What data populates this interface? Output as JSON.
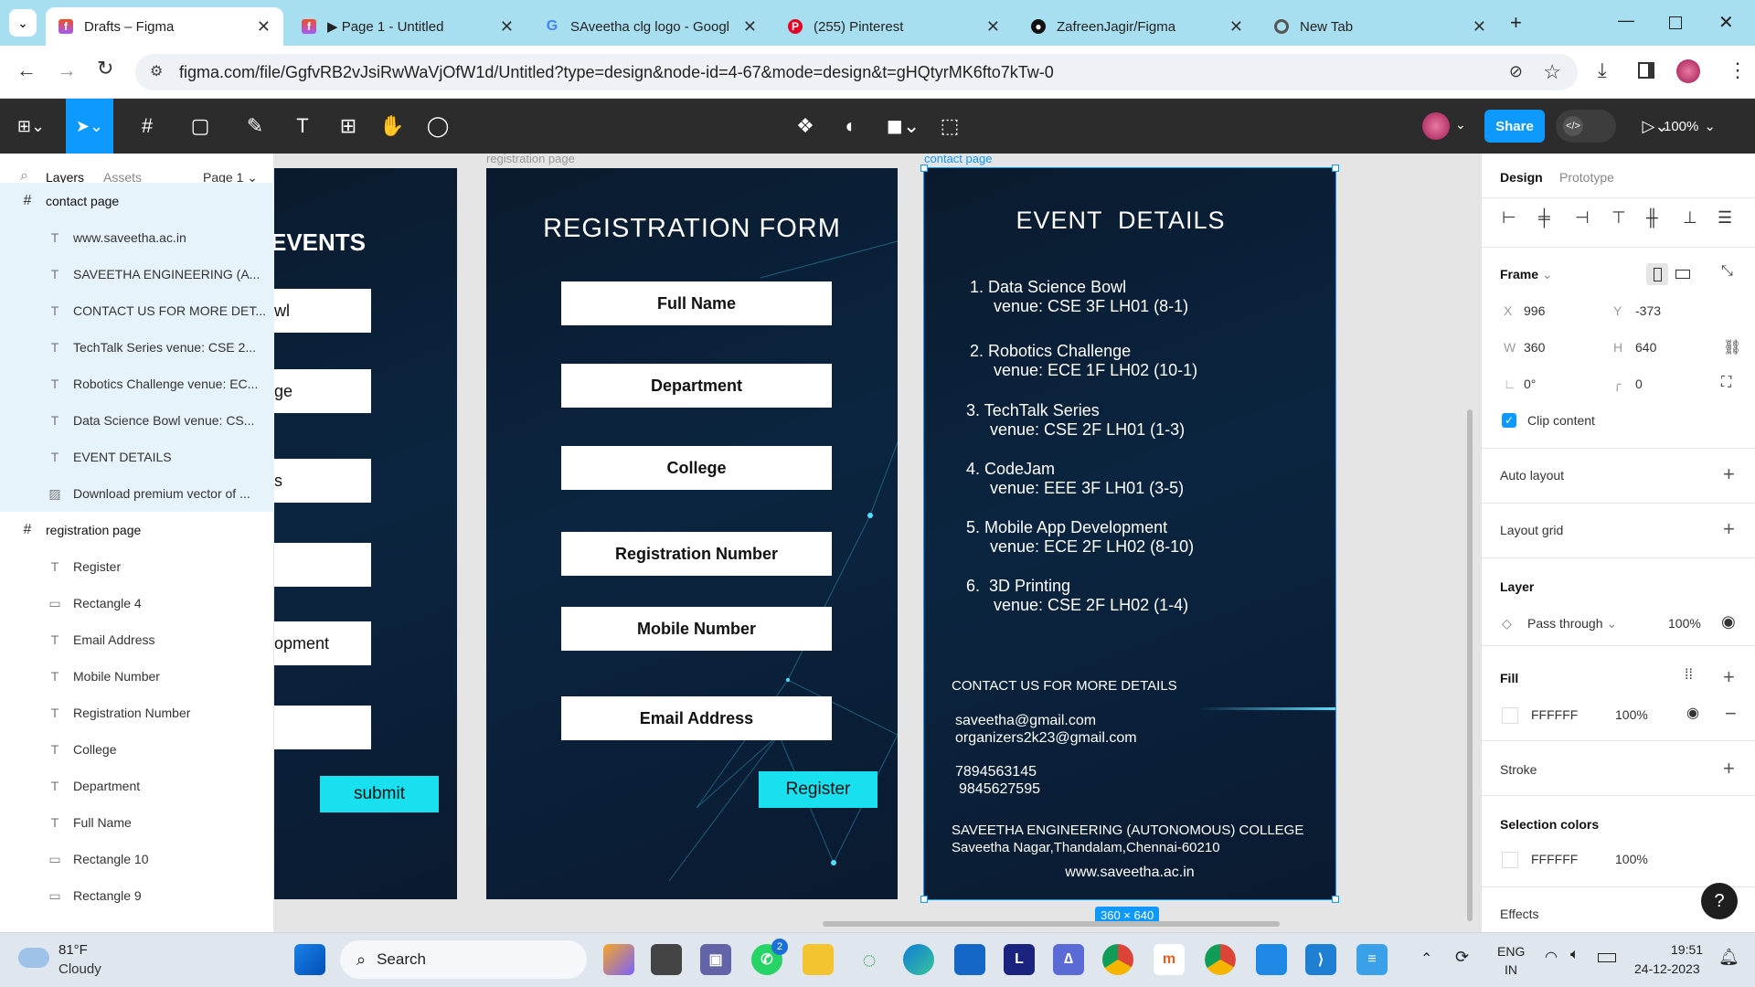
{
  "browser": {
    "tabs": [
      {
        "label": "Drafts – Figma",
        "icon": "figma-icon"
      },
      {
        "label": "▶ Page 1 - Untitled",
        "icon": "figma-icon"
      },
      {
        "label": "SAveetha clg logo - Googl",
        "icon": "google-icon"
      },
      {
        "label": "(255) Pinterest",
        "icon": "pinterest-icon"
      },
      {
        "label": "ZafreenJagir/Figma",
        "icon": "github-icon"
      },
      {
        "label": "New Tab",
        "icon": "chrome-icon"
      }
    ],
    "url": "figma.com/file/GgfvRB2vJsiRwWaVjOfW1d/Untitled?type=design&node-id=4-67&mode=design&t=gHQtyrMK6fto7kTw-0"
  },
  "figma_toolbar": {
    "share_label": "Share",
    "zoom": "100%"
  },
  "left_panel": {
    "tab_layers": "Layers",
    "tab_assets": "Assets",
    "page": "Page 1",
    "layers": [
      {
        "label": "contact page",
        "type": "frame",
        "selected": true
      },
      {
        "label": "www.saveetha.ac.in",
        "type": "text",
        "selected": true
      },
      {
        "label": "SAVEETHA ENGINEERING (A...",
        "type": "text",
        "selected": true
      },
      {
        "label": "CONTACT US FOR MORE DET...",
        "type": "text",
        "selected": true
      },
      {
        "label": "TechTalk Series venue: CSE 2...",
        "type": "text",
        "selected": true
      },
      {
        "label": "Robotics Challenge venue: EC...",
        "type": "text",
        "selected": true
      },
      {
        "label": "Data Science Bowl venue: CS...",
        "type": "text",
        "selected": true
      },
      {
        "label": "EVENT DETAILS",
        "type": "text",
        "selected": true
      },
      {
        "label": "Download premium vector of ...",
        "type": "image",
        "selected": true
      },
      {
        "label": "registration page",
        "type": "frame",
        "selected": false
      },
      {
        "label": "Register",
        "type": "text",
        "selected": false
      },
      {
        "label": "Rectangle 4",
        "type": "rect",
        "selected": false
      },
      {
        "label": "Email Address",
        "type": "text",
        "selected": false
      },
      {
        "label": "Mobile Number",
        "type": "text",
        "selected": false
      },
      {
        "label": "Registration Number",
        "type": "text",
        "selected": false
      },
      {
        "label": "College",
        "type": "text",
        "selected": false
      },
      {
        "label": "Department",
        "type": "text",
        "selected": false
      },
      {
        "label": "Full Name",
        "type": "text",
        "selected": false
      },
      {
        "label": "Rectangle 10",
        "type": "rect",
        "selected": false
      },
      {
        "label": "Rectangle 9",
        "type": "rect",
        "selected": false
      }
    ]
  },
  "canvas": {
    "left_frame": {
      "title": "EVENTS",
      "fields": [
        "wl",
        "ge",
        "s",
        "",
        "opment",
        ""
      ],
      "submit": "submit"
    },
    "registration": {
      "frame_label": "registration page",
      "title": "REGISTRATION FORM",
      "fields": [
        "Full Name",
        "Department",
        "College",
        "Registration Number",
        "Mobile Number",
        "Email  Address"
      ],
      "register": "Register"
    },
    "contact": {
      "frame_label": "contact page",
      "title": "EVENT  DETAILS",
      "events": [
        {
          "line1": "1. Data Science Bowl",
          "line2": "venue: CSE 3F LH01 (8-1)"
        },
        {
          "line1": "2. Robotics Challenge",
          "line2": "venue: ECE 1F LH02 (10-1)"
        },
        {
          "line1": "3. TechTalk Series",
          "line2": "venue: CSE 2F LH01 (1-3)"
        },
        {
          "line1": "4. CodeJam",
          "line2": "venue: EEE 3F LH01 (3-5)"
        },
        {
          "line1": "5. Mobile App Development",
          "line2": "venue: ECE 2F LH02 (8-10)"
        },
        {
          "line1": "6.  3D Printing",
          "line2": "venue: CSE 2F LH02 (1-4)"
        }
      ],
      "contact_heading": "CONTACT US FOR MORE DETAILS",
      "email1": "saveetha@gmail.com",
      "email2": "organizers2k23@gmail.com",
      "phone1": "7894563145",
      "phone2": "9845627595",
      "college": "SAVEETHA ENGINEERING (AUTONOMOUS) COLLEGE",
      "address": "Saveetha Nagar,Thandalam,Chennai-60210",
      "website": "www.saveetha.ac.in",
      "size_badge": "360 × 640"
    }
  },
  "right_panel": {
    "tab_design": "Design",
    "tab_prototype": "Prototype",
    "frame_label": "Frame",
    "x_label": "X",
    "x": "996",
    "y_label": "Y",
    "y": "-373",
    "w_label": "W",
    "w": "360",
    "h_label": "H",
    "h": "640",
    "rotation": "0°",
    "radius": "0",
    "clip_content": "Clip content",
    "auto_layout": "Auto layout",
    "layout_grid": "Layout grid",
    "layer_heading": "Layer",
    "blend": "Pass through",
    "layer_opacity": "100%",
    "fill_heading": "Fill",
    "fill_hex": "FFFFFF",
    "fill_opacity": "100%",
    "stroke": "Stroke",
    "selection_colors": "Selection colors",
    "sel_hex": "FFFFFF",
    "sel_opacity": "100%",
    "effects": "Effects"
  },
  "taskbar": {
    "temp": "81°F",
    "weather": "Cloudy",
    "search": "Search",
    "whatsapp_badge": "2",
    "lang1": "ENG",
    "lang2": "IN",
    "time": "19:51",
    "date": "24-12-2023"
  }
}
